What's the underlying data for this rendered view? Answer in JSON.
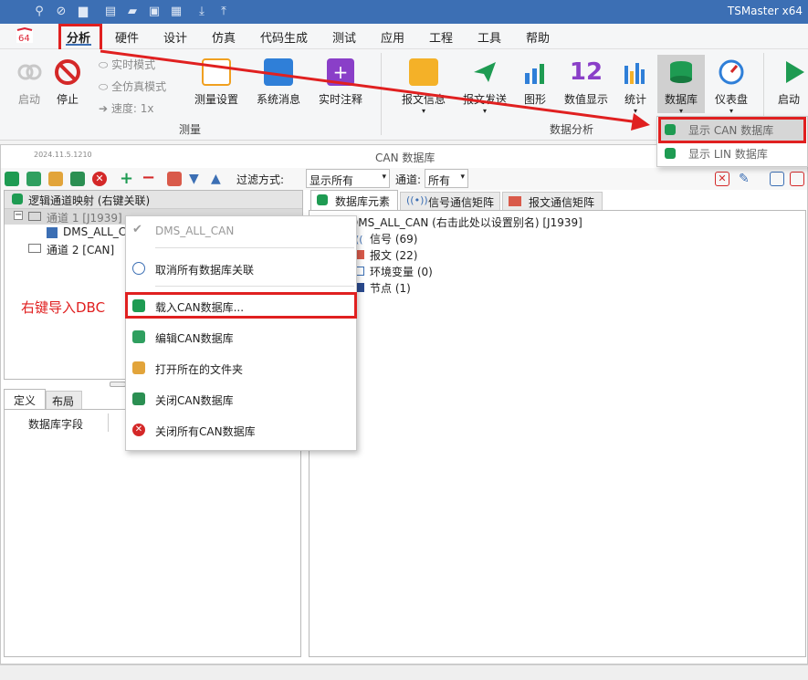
{
  "titlebar": {
    "app_title": "TSMaster x64"
  },
  "menubar": {
    "items": [
      "分析",
      "硬件",
      "设计",
      "仿真",
      "代码生成",
      "测试",
      "应用",
      "工程",
      "工具",
      "帮助"
    ]
  },
  "ribbon": {
    "start_label": "启动",
    "stop_label": "停止",
    "realtime_mode": "实时模式",
    "full_sim_mode": "全仿真模式",
    "speed_label": "速度: 1x",
    "measure_setup": "测量设置",
    "system_message": "系统消息",
    "realtime_note": "实时注释",
    "group_measure": "测量",
    "msg_info": "报文信息",
    "msg_send": "报文发送",
    "graphic": "图形",
    "value_display": "数值显示",
    "value_num": "12",
    "statistics": "统计",
    "database": "数据库",
    "dashboard": "仪表盘",
    "start_right": "启动",
    "group_data_analysis": "数据分析",
    "dropdown": [
      "显示 CAN 数据库",
      "显示 LIN 数据库"
    ]
  },
  "window": {
    "version": "2024.11.5.1210",
    "title": "CAN 数据库"
  },
  "toolbar": {
    "filter_label": "过滤方式:",
    "filter_value": "显示所有",
    "channel_label": "通道:",
    "channel_value": "所有"
  },
  "left_tree": {
    "root": "逻辑通道映射 (右键关联)",
    "channel1": "通道 1 [J1939]",
    "db_node": "DMS_ALL_CA",
    "channel2": "通道 2 [CAN]"
  },
  "bottom_tabs": [
    "定义",
    "布局"
  ],
  "field_header": "数据库字段",
  "right_tabs": [
    "数据库元素",
    "信号通信矩阵",
    "报文通信矩阵"
  ],
  "right_tree": {
    "db": "DMS_ALL_CAN (右击此处以设置别名) [J1939]",
    "signals": "信号 (69)",
    "messages": "报文 (22)",
    "env_vars": "环境变量 (0)",
    "nodes": "节点 (1)"
  },
  "context_menu": [
    "DMS_ALL_CAN",
    "取消所有数据库关联",
    "载入CAN数据库...",
    "编辑CAN数据库",
    "打开所在的文件夹",
    "关闭CAN数据库",
    "关闭所有CAN数据库"
  ],
  "annotation": "右键导入DBC",
  "colors": {
    "accent": "#3c6fb4",
    "highlight": "#e02020"
  }
}
